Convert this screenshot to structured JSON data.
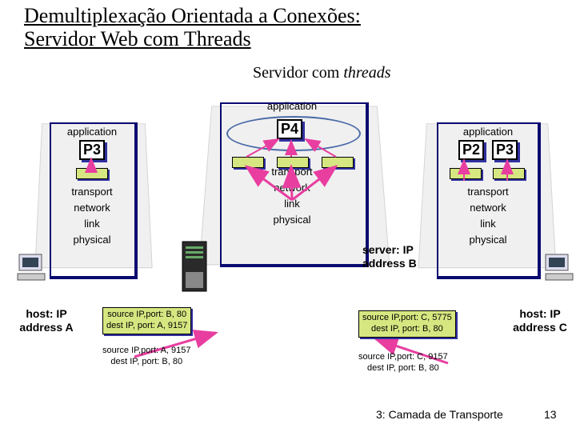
{
  "title_line1": "Demultiplexação Orientada a Conexões:",
  "title_line2": "Servidor Web com Threads",
  "subtitle_pre": "Servidor com ",
  "subtitle_it": "threads",
  "layers": {
    "application": "application",
    "transport": "transport",
    "network": "network",
    "link": "link",
    "physical": "physical"
  },
  "procs": {
    "P2": "P2",
    "P3": "P3",
    "P4": "P4"
  },
  "server_label": "server: IP address B",
  "host_a": "host: IP address A",
  "host_c": "host: IP address C",
  "pkt_left_top_l1": "source IP,port: B, 80",
  "pkt_left_top_l2": "dest IP, port: A, 9157",
  "pkt_left_bot_l1": "source IP,port: A, 9157",
  "pkt_left_bot_l2": "dest IP, port: B, 80",
  "pkt_right_top_l1": "source IP,port: C, 5775",
  "pkt_right_top_l2": "dest IP, port: B, 80",
  "pkt_right_bot_l1": "source IP,port: C, 9157",
  "pkt_right_bot_l2": "dest IP, port: B, 80",
  "footer": "3: Camada de Transporte",
  "pagenum": "13"
}
